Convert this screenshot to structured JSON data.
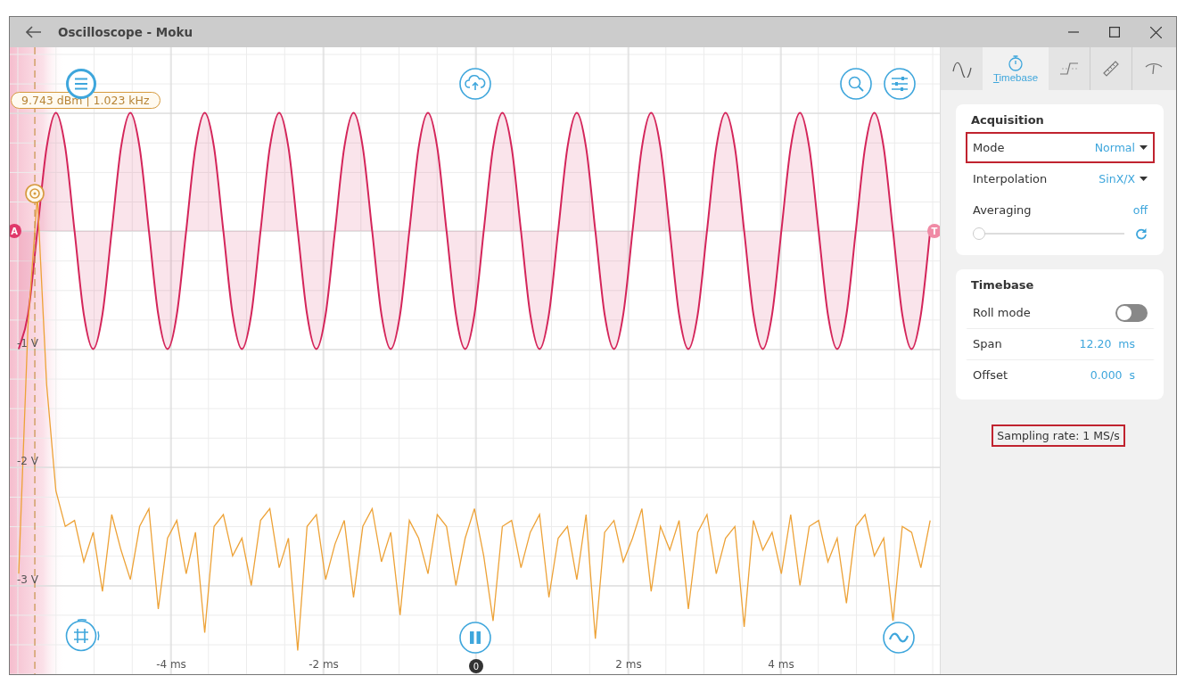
{
  "window": {
    "title": "Oscilloscope - Moku"
  },
  "plot": {
    "measurement": "9.743 dBm | 1.023 kHz",
    "trigger_marker": "T",
    "zero_marker": "0",
    "chart_data": {
      "type": "line",
      "grid": true,
      "xlim": [
        -6.117,
        6.082
      ],
      "ref_lines": [
        {
          "axis": "x",
          "value": -5.789,
          "color": "#c8924a"
        }
      ],
      "ylim": [
        -3.766,
        1.555
      ],
      "x": [
        -6,
        -5.878,
        -5.756,
        -5.634,
        -5.512,
        -5.39,
        -5.268,
        -5.146,
        -5.024,
        -4.902,
        -4.78,
        -4.658,
        -4.536,
        -4.414,
        -4.292,
        -4.17,
        -4.048,
        -3.926,
        -3.804,
        -3.682,
        -3.56,
        -3.438,
        -3.316,
        -3.194,
        -3.072,
        -2.95,
        -2.828,
        -2.706,
        -2.584,
        -2.462,
        -2.34,
        -2.218,
        -2.096,
        -1.974,
        -1.852,
        -1.73,
        -1.608,
        -1.486,
        -1.364,
        -1.242,
        -1.12,
        -0.998,
        -0.876,
        -0.754,
        -0.632,
        -0.51,
        -0.388,
        -0.266,
        -0.144,
        -0.022,
        0.1,
        0.222,
        0.344,
        0.466,
        0.588,
        0.71,
        0.832,
        0.954,
        1.076,
        1.198,
        1.32,
        1.442,
        1.564,
        1.686,
        1.808,
        1.93,
        2.052,
        2.174,
        2.296,
        2.418,
        2.54,
        2.662,
        2.784,
        2.906,
        3.028,
        3.15,
        3.272,
        3.394,
        3.516,
        3.638,
        3.76,
        3.882,
        4.004,
        4.126,
        4.248,
        4.37,
        4.492,
        4.614,
        4.736,
        4.858,
        4.98,
        5.102,
        5.224,
        5.346,
        5.468,
        5.59,
        5.712,
        5.834,
        5.956
      ],
      "xticks": [
        {
          "value": -4,
          "label": "-4 ms"
        },
        {
          "value": -2,
          "label": "-2 ms"
        },
        {
          "value": 2,
          "label": "2 ms"
        },
        {
          "value": 4,
          "label": "4 ms"
        }
      ],
      "yticks": [
        {
          "value": -1,
          "label": "-1 V"
        },
        {
          "value": -2,
          "label": "-2 V"
        },
        {
          "value": -3,
          "label": "-3 V"
        }
      ],
      "series": [
        {
          "name": "A",
          "color": "#d4255a",
          "values": [
            -1,
            -0.707,
            0,
            0.707,
            1,
            0.707,
            0,
            -0.707,
            -1,
            -0.707,
            0,
            0.707,
            1,
            0.707,
            0,
            -0.707,
            -1,
            -0.707,
            0,
            0.707,
            1,
            0.707,
            0,
            -0.707,
            -1,
            -0.707,
            0,
            0.707,
            1,
            0.707,
            0,
            -0.707,
            -1,
            -0.707,
            0,
            0.707,
            1,
            0.707,
            0,
            -0.707,
            -1,
            -0.707,
            0,
            0.707,
            1,
            0.707,
            0,
            -0.707,
            -1,
            -0.707,
            0,
            0.707,
            1,
            0.707,
            0,
            -0.707,
            -1,
            -0.707,
            0,
            0.707,
            1,
            0.707,
            0,
            -0.707,
            -1,
            -0.707,
            0,
            0.707,
            1,
            0.707,
            0,
            -0.707,
            -1,
            -0.707,
            0,
            0.707,
            1,
            0.707,
            0,
            -0.707,
            -1,
            -0.707,
            0,
            0.707,
            1,
            0.707,
            0,
            -0.707,
            -1,
            -0.707,
            0,
            0.707,
            1,
            0.707,
            0,
            -0.707,
            -1,
            -0.707,
            0
          ]
        },
        {
          "color": "#eda237",
          "values": [
            -2.9,
            -0.8,
            0.3,
            -1.3,
            -2.2,
            -2.5,
            -2.45,
            -2.8,
            -2.55,
            -3.05,
            -2.4,
            -2.7,
            -2.95,
            -2.5,
            -2.35,
            -3.2,
            -2.6,
            -2.45,
            -2.9,
            -2.55,
            -3.4,
            -2.5,
            -2.4,
            -2.75,
            -2.6,
            -3.0,
            -2.45,
            -2.35,
            -2.85,
            -2.6,
            -3.55,
            -2.5,
            -2.4,
            -2.95,
            -2.65,
            -2.45,
            -3.1,
            -2.5,
            -2.35,
            -2.8,
            -2.55,
            -3.25,
            -2.45,
            -2.6,
            -2.9,
            -2.4,
            -2.5,
            -3.0,
            -2.6,
            -2.35,
            -2.75,
            -3.3,
            -2.5,
            -2.45,
            -2.85,
            -2.55,
            -2.4,
            -3.1,
            -2.6,
            -2.5,
            -2.95,
            -2.4,
            -3.45,
            -2.55,
            -2.45,
            -2.8,
            -2.6,
            -2.35,
            -3.05,
            -2.5,
            -2.7,
            -2.45,
            -3.2,
            -2.55,
            -2.4,
            -2.9,
            -2.6,
            -2.5,
            -3.35,
            -2.45,
            -2.7,
            -2.55,
            -2.9,
            -2.4,
            -3.0,
            -2.5,
            -2.45,
            -2.8,
            -2.6,
            -3.15,
            -2.5,
            -2.4,
            -2.75,
            -2.6,
            -3.3,
            -2.5,
            -2.55,
            -2.85,
            -2.45
          ]
        }
      ]
    }
  },
  "tabs": [
    {
      "kind": "sine",
      "selected": false
    },
    {
      "kind": "stopwatch",
      "label": "Timebase",
      "selected": true
    },
    {
      "kind": "step",
      "selected": false
    },
    {
      "kind": "ruler",
      "selected": false
    },
    {
      "kind": "gauge",
      "selected": false
    }
  ],
  "acquisition": {
    "title": "Acquisition",
    "rows": [
      {
        "kind": "dropdown",
        "label": "Mode",
        "value": "Normal",
        "highlighted": true
      },
      {
        "kind": "dropdown",
        "label": "Interpolation",
        "value": "SinX/X",
        "highlighted": false
      },
      {
        "kind": "slider",
        "label": "Averaging",
        "value": "off",
        "level": 0,
        "highlighted": false
      }
    ]
  },
  "timebase": {
    "title": "Timebase",
    "rows": [
      {
        "kind": "toggle",
        "label": "Roll mode",
        "on": false
      },
      {
        "kind": "value",
        "label": "Span",
        "value": "12.20",
        "unit": "ms"
      },
      {
        "kind": "value",
        "label": "Offset",
        "value": "0.000",
        "unit": "s"
      }
    ]
  },
  "sampling_rate": {
    "text": "Sampling rate: 1 MS/s",
    "highlighted": true
  }
}
